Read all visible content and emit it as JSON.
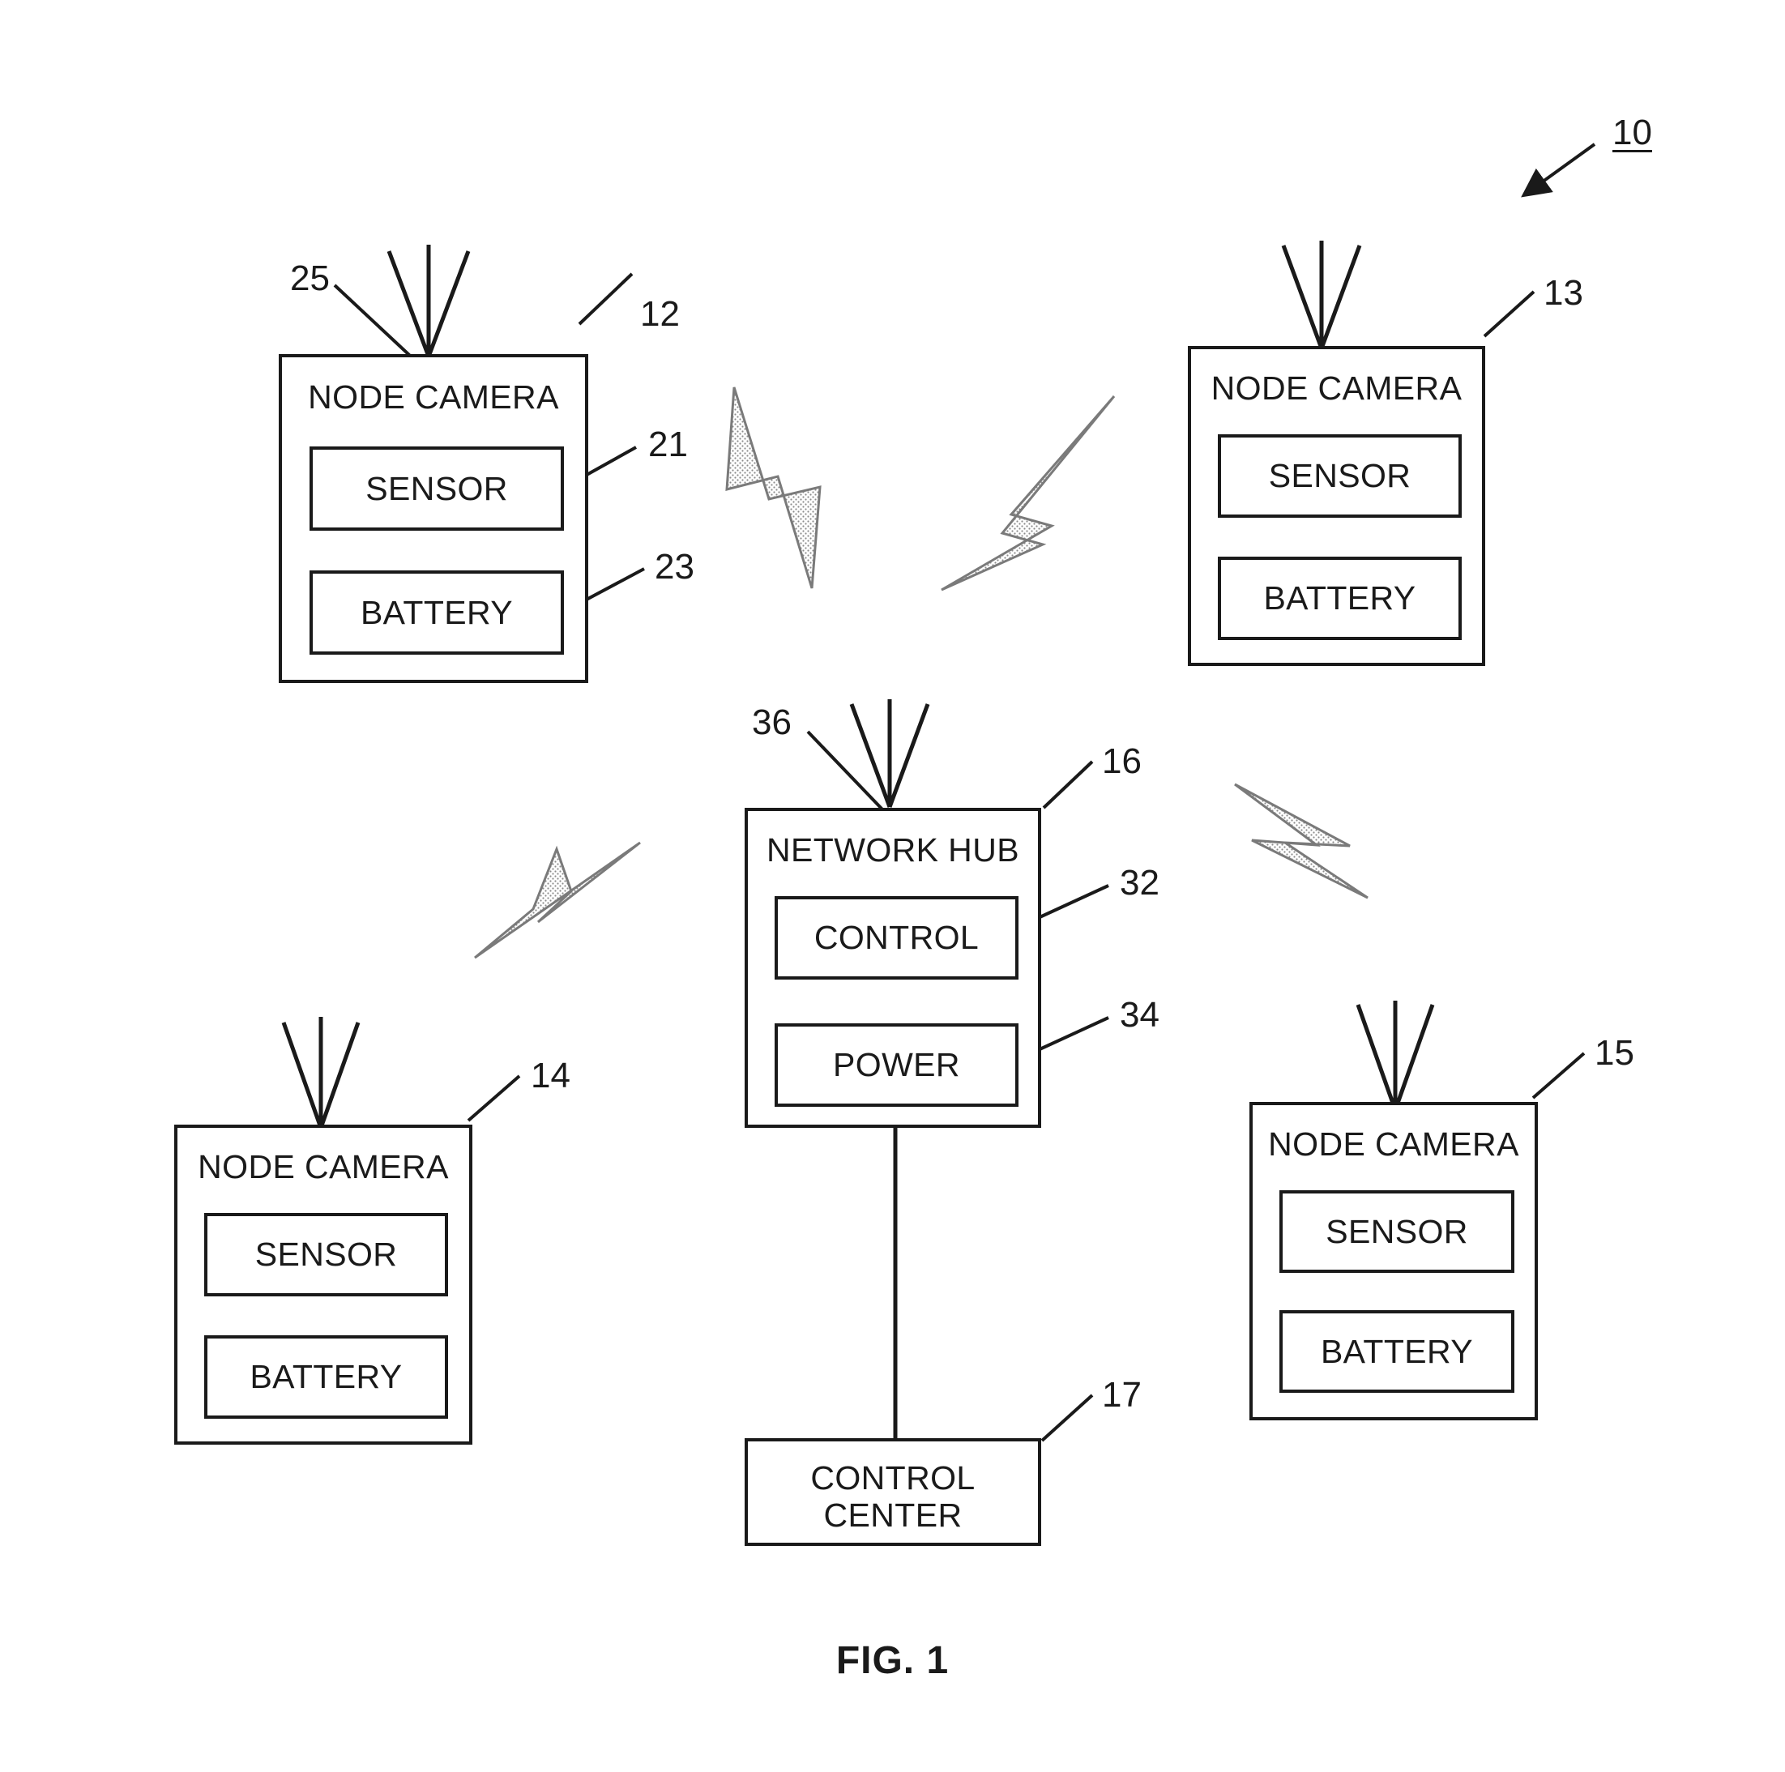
{
  "figure": {
    "caption": "FIG. 1",
    "system_ref": "10"
  },
  "nodes": [
    {
      "id": "node-camera-12",
      "title": "NODE CAMERA",
      "ref": "12",
      "antenna_ref": "25",
      "modules": [
        {
          "label": "SENSOR",
          "ref": "21"
        },
        {
          "label": "BATTERY",
          "ref": "23"
        }
      ]
    },
    {
      "id": "node-camera-13",
      "title": "NODE CAMERA",
      "ref": "13",
      "antenna_ref": "",
      "modules": [
        {
          "label": "SENSOR",
          "ref": ""
        },
        {
          "label": "BATTERY",
          "ref": ""
        }
      ]
    },
    {
      "id": "node-camera-14",
      "title": "NODE CAMERA",
      "ref": "14",
      "antenna_ref": "",
      "modules": [
        {
          "label": "SENSOR",
          "ref": ""
        },
        {
          "label": "BATTERY",
          "ref": ""
        }
      ]
    },
    {
      "id": "node-camera-15",
      "title": "NODE CAMERA",
      "ref": "15",
      "antenna_ref": "",
      "modules": [
        {
          "label": "SENSOR",
          "ref": ""
        },
        {
          "label": "BATTERY",
          "ref": ""
        }
      ]
    }
  ],
  "hub": {
    "id": "network-hub-16",
    "title": "NETWORK HUB",
    "ref": "16",
    "antenna_ref": "36",
    "modules": [
      {
        "label": "CONTROL",
        "ref": "32"
      },
      {
        "label": "POWER",
        "ref": "34"
      }
    ]
  },
  "control_center": {
    "id": "control-center-17",
    "title_line_1": "CONTROL",
    "title_line_2": "CENTER",
    "ref": "17"
  },
  "links": {
    "wireless_count": 4,
    "wired_label": ""
  },
  "colors": {
    "line": "#1a1a1a",
    "bolt_fill": "#b4b4b4",
    "bolt_stroke": "#6e6e6e",
    "background": "#ffffff"
  }
}
